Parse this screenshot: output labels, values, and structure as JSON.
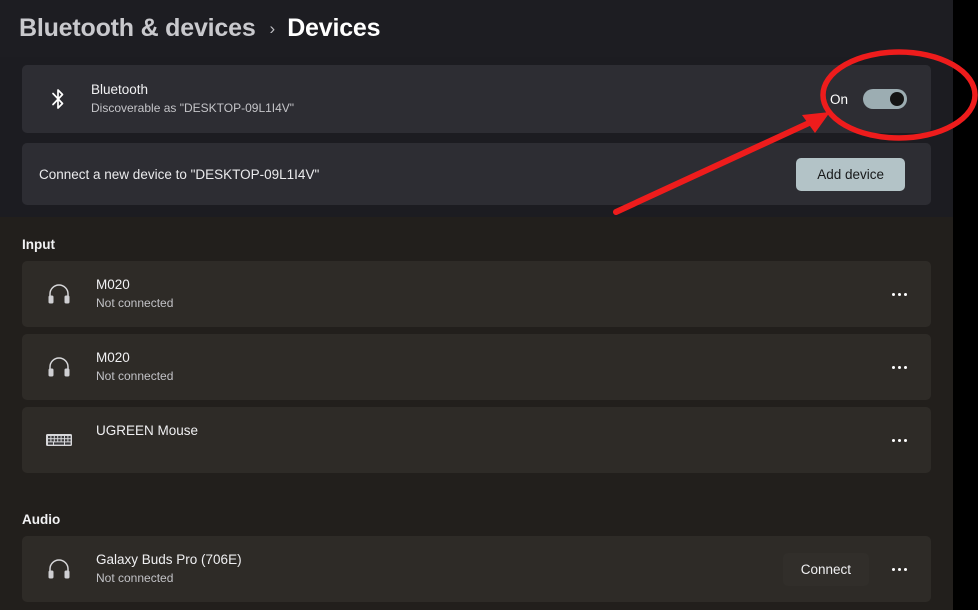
{
  "header": {
    "breadcrumb_parent": "Bluetooth & devices",
    "breadcrumb_separator": "›",
    "breadcrumb_current": "Devices"
  },
  "bluetooth_card": {
    "icon": "bluetooth-icon",
    "title": "Bluetooth",
    "subtitle": "Discoverable as \"DESKTOP-09L1I4V\"",
    "toggle_label": "On",
    "toggle_state": "on"
  },
  "add_device_row": {
    "text": "Connect a new device to \"DESKTOP-09L1I4V\"",
    "button_label": "Add device"
  },
  "sections": [
    {
      "label": "Input",
      "devices": [
        {
          "icon": "headphones-icon",
          "name": "M020",
          "status": "Not connected",
          "status_type": "text",
          "more_label": "•••"
        },
        {
          "icon": "headphones-icon",
          "name": "M020",
          "status": "Not connected",
          "status_type": "text",
          "more_label": "•••"
        },
        {
          "icon": "keyboard-icon",
          "name": "UGREEN Mouse",
          "status": "",
          "status_type": "dot",
          "more_label": "•••"
        }
      ]
    },
    {
      "label": "Audio",
      "devices": [
        {
          "icon": "headphones-icon",
          "name": "Galaxy Buds Pro (706E)",
          "status": "Not connected",
          "status_type": "text",
          "action_label": "Connect",
          "more_label": "•••"
        }
      ]
    }
  ],
  "colors": {
    "page_background": "#221f1c",
    "header_background": "#1d1d22",
    "card_top": "#2d2d33",
    "card_device": "#2e2b27",
    "accent_button": "#b3c3c7",
    "toggle_track": "#9cadb2",
    "status_connected": "#4cb94c",
    "annotation": "#ee1c1c"
  },
  "annotation": {
    "shape": "ellipse-and-arrow",
    "target": "bluetooth-toggle",
    "color": "#ee1c1c"
  }
}
